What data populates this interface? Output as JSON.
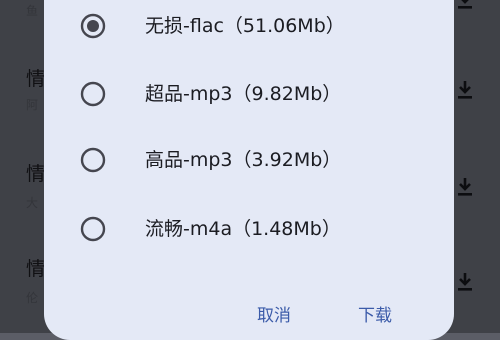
{
  "background_list": {
    "items": [
      {
        "title": "",
        "subtitle": "鱼"
      },
      {
        "title": "情",
        "subtitle": "阿"
      },
      {
        "title": "情",
        "subtitle": "大"
      },
      {
        "title": "情",
        "subtitle": "伦"
      }
    ]
  },
  "dialog": {
    "options": [
      {
        "label": "无损-flac（51.06Mb）",
        "selected": true
      },
      {
        "label": "超品-mp3（9.82Mb）",
        "selected": false
      },
      {
        "label": "高品-mp3（3.92Mb）",
        "selected": false
      },
      {
        "label": "流畅-m4a（1.48Mb）",
        "selected": false
      }
    ],
    "cancel_label": "取消",
    "download_label": "下载"
  },
  "colors": {
    "accent": "#3b5ba9",
    "dialog_bg": "#e4e9f6",
    "radio": "#45464f"
  }
}
